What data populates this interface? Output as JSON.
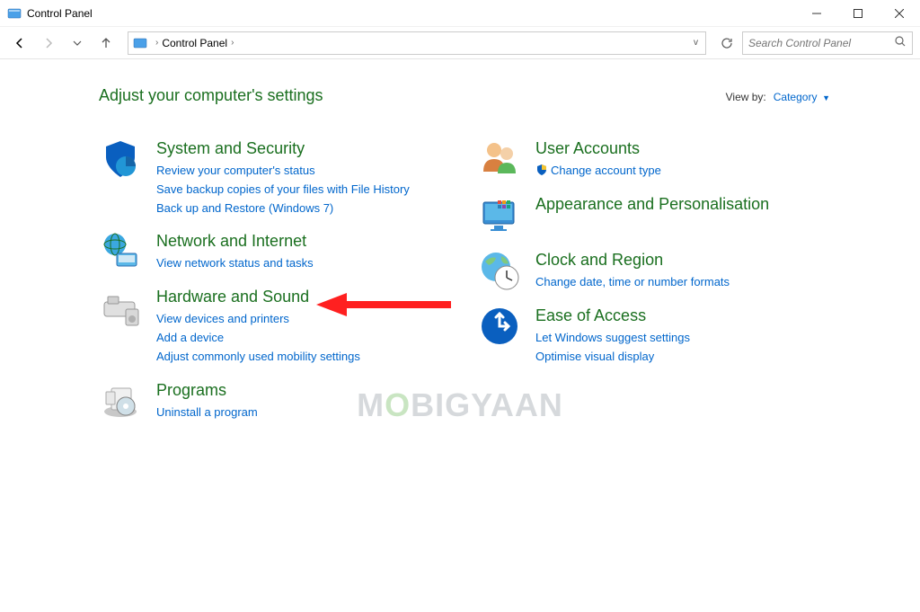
{
  "window": {
    "title": "Control Panel"
  },
  "breadcrumb": {
    "item": "Control Panel"
  },
  "search": {
    "placeholder": "Search Control Panel"
  },
  "header": {
    "title": "Adjust your computer's settings",
    "viewby_label": "View by:",
    "viewby_value": "Category"
  },
  "left": {
    "system": {
      "title": "System and Security",
      "links": [
        "Review your computer's status",
        "Save backup copies of your files with File History",
        "Back up and Restore (Windows 7)"
      ]
    },
    "network": {
      "title": "Network and Internet",
      "links": [
        "View network status and tasks"
      ]
    },
    "hardware": {
      "title": "Hardware and Sound",
      "links": [
        "View devices and printers",
        "Add a device",
        "Adjust commonly used mobility settings"
      ]
    },
    "programs": {
      "title": "Programs",
      "links": [
        "Uninstall a program"
      ]
    }
  },
  "right": {
    "user": {
      "title": "User Accounts",
      "links": [
        "Change account type"
      ]
    },
    "appearance": {
      "title": "Appearance and Personalisation"
    },
    "clock": {
      "title": "Clock and Region",
      "links": [
        "Change date, time or number formats"
      ]
    },
    "ease": {
      "title": "Ease of Access",
      "links": [
        "Let Windows suggest settings",
        "Optimise visual display"
      ]
    }
  },
  "watermark": "MOBIGYAAN"
}
